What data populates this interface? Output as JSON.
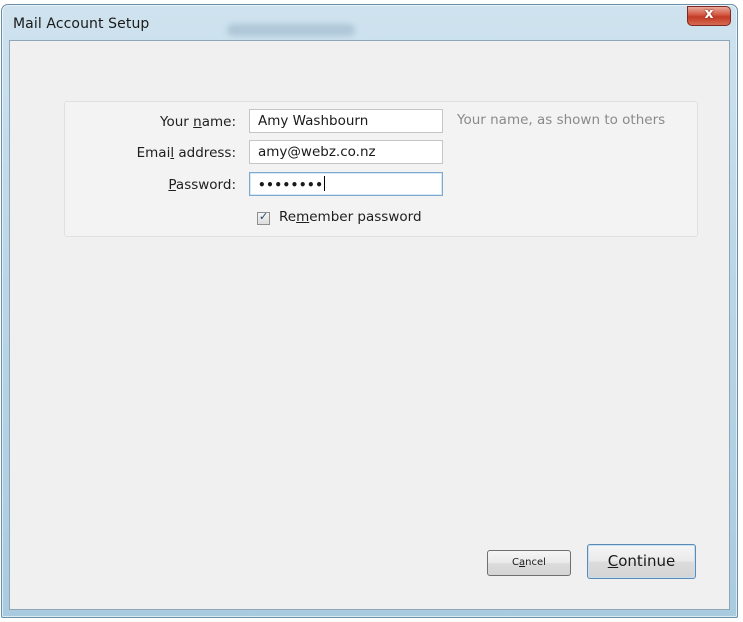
{
  "window": {
    "title": "Mail Account Setup",
    "close_glyph": "x"
  },
  "form": {
    "name_label_pre": "Your ",
    "name_label_key": "n",
    "name_label_post": "ame:",
    "name_value": "Amy Washbourn",
    "name_hint": "Your name, as shown to others",
    "email_label_pre": "Emai",
    "email_label_key": "l",
    "email_label_post": " address:",
    "email_value": "amy@webz.co.nz",
    "password_label_key": "P",
    "password_label_post": "assword:",
    "password_value": "••••••••",
    "remember_label_pre": "Re",
    "remember_label_key": "m",
    "remember_label_post": "ember password",
    "remember_checked": true
  },
  "buttons": {
    "cancel_pre": "C",
    "cancel_key": "a",
    "cancel_post": "ncel",
    "continue_key": "C",
    "continue_post": "ontinue"
  },
  "icons": {
    "close": "close-icon",
    "checkbox_tick": "check-icon"
  },
  "colors": {
    "close_button": "#c23b25",
    "hint_text": "#8a8a8a",
    "focus_border": "#7fa9d0"
  }
}
